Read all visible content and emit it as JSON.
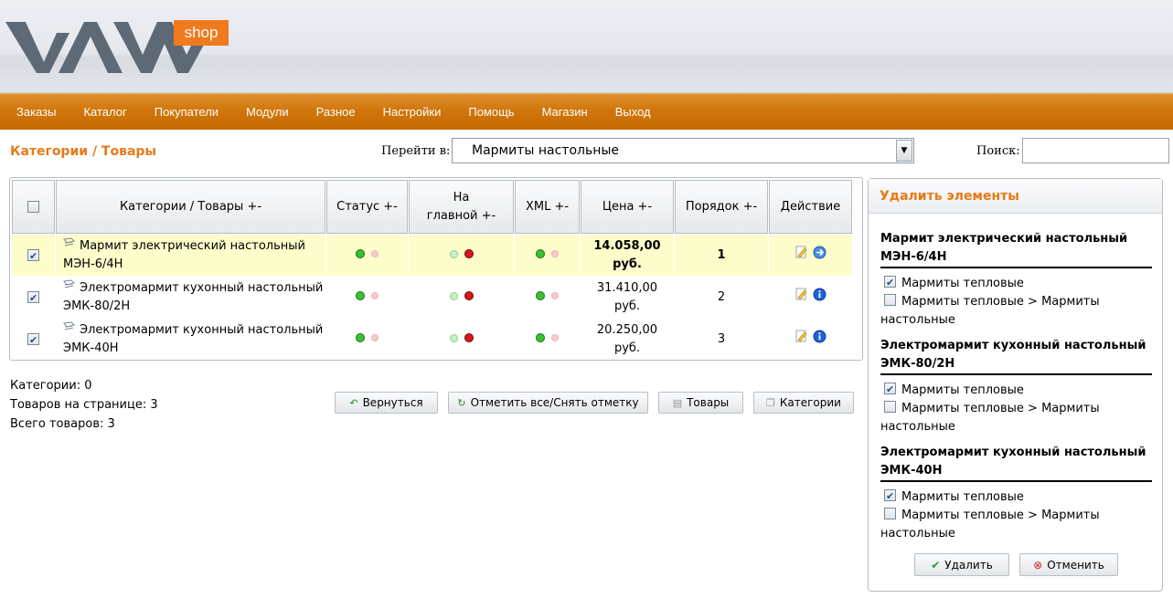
{
  "header": {
    "logo_text": "VAM",
    "logo_badge": "shop"
  },
  "menu": [
    "Заказы",
    "Каталог",
    "Покупатели",
    "Модули",
    "Разное",
    "Настройки",
    "Помощь",
    "Магазин",
    "Выход"
  ],
  "page": {
    "title": "Категории / Товары",
    "goto_label": "Перейти в:",
    "goto_value": "Мармиты настольные",
    "search_label": "Поиск:",
    "search_value": ""
  },
  "table": {
    "headers": {
      "name": "Категории / Товары +-",
      "status": "Статус +-",
      "main_line1": "На",
      "main_line2": "главной +-",
      "xml": "XML +-",
      "price": "Цена +-",
      "order": "Порядок +-",
      "action": "Действие"
    },
    "rows": [
      {
        "checked": true,
        "name_line1": "Мармит электрический настольный",
        "name_line2": "МЭН-6/4Н",
        "price_line1": "14.058,00",
        "price_line2": "руб.",
        "order": "1",
        "highlight": true
      },
      {
        "checked": true,
        "name_line1": "Электромармит кухонный настольный",
        "name_line2": "ЭМК-80/2Н",
        "price_line1": "31.410,00",
        "price_line2": "руб.",
        "order": "2",
        "highlight": false
      },
      {
        "checked": true,
        "name_line1": "Электромармит кухонный настольный",
        "name_line2": "ЭМК-40Н",
        "price_line1": "20.250,00",
        "price_line2": "руб.",
        "order": "3",
        "highlight": false
      }
    ]
  },
  "summary": {
    "categories": "Категории: 0",
    "per_page": "Товаров на странице: 3",
    "total": "Всего товаров: 3"
  },
  "buttons": {
    "back": "Вернуться",
    "toggle_all": "Отметить все/Снять отметку",
    "products": "Товары",
    "categories": "Категории"
  },
  "delete_panel": {
    "title": "Удалить элементы",
    "items": [
      {
        "title_line1": "Мармит электрический настольный",
        "title_line2": "МЭН-6/4Н",
        "opt1": "Мармиты тепловые",
        "opt2_line1": "Мармиты тепловые > Мармиты",
        "opt2_line2": "настольные"
      },
      {
        "title_line1": "Электромармит кухонный настольный",
        "title_line2": "ЭМК-80/2Н",
        "opt1": "Мармиты тепловые",
        "opt2_line1": "Мармиты тепловые > Мармиты",
        "opt2_line2": "настольные"
      },
      {
        "title_line1": "Электромармит кухонный настольный",
        "title_line2": "ЭМК-40Н",
        "opt1": "Мармиты тепловые",
        "opt2_line1": "Мармиты тепловые > Мармиты",
        "opt2_line2": "настольные"
      }
    ],
    "delete_label": "Удалить",
    "cancel_label": "Отменить"
  },
  "colors": {
    "accent": "#e77a16",
    "menu_bg": "#d0760b",
    "row_highlight": "#fdfccb"
  }
}
